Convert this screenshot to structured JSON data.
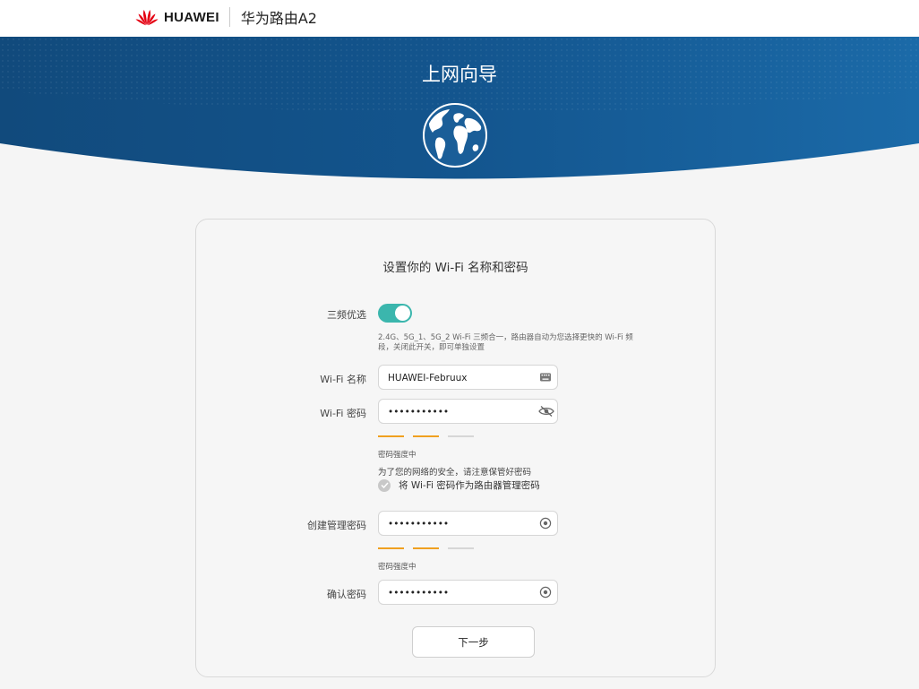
{
  "header": {
    "brand": "HUAWEI",
    "product": "华为路由A2"
  },
  "hero": {
    "title": "上网向导",
    "icon": "globe-icon"
  },
  "form": {
    "title": "设置你的 Wi-Fi 名称和密码",
    "tri_band_label": "三频优选",
    "tri_band_on": true,
    "tri_band_hint": "2.4G、5G_1、5G_2 Wi-Fi 三频合一，路由器自动为您选择更快的 Wi-Fi 频段，关闭此开关，即可单独设置",
    "wifi_name_label": "Wi-Fi 名称",
    "wifi_name_value": "HUAWEI-Februux",
    "wifi_password_label": "Wi-Fi 密码",
    "wifi_password_value": "•••••••••••",
    "wifi_strength_text": "密码强度中",
    "wifi_strength_level": 2,
    "security_notice": "为了您的网络的安全，请注意保管好密码",
    "reuse_label": "将 Wi-Fi 密码作为路由器管理密码",
    "admin_password_label": "创建管理密码",
    "admin_password_value": "•••••••••••",
    "admin_strength_text": "密码强度中",
    "admin_strength_level": 2,
    "confirm_label": "确认密码",
    "confirm_value": "•••••••••••",
    "next_label": "下一步"
  },
  "colors": {
    "hero_dark": "#114a7c",
    "hero_light": "#1b6aa8",
    "toggle_on": "#3bb6ad",
    "strength_active": "#f0a020",
    "strength_inactive": "#d6d6d6"
  }
}
